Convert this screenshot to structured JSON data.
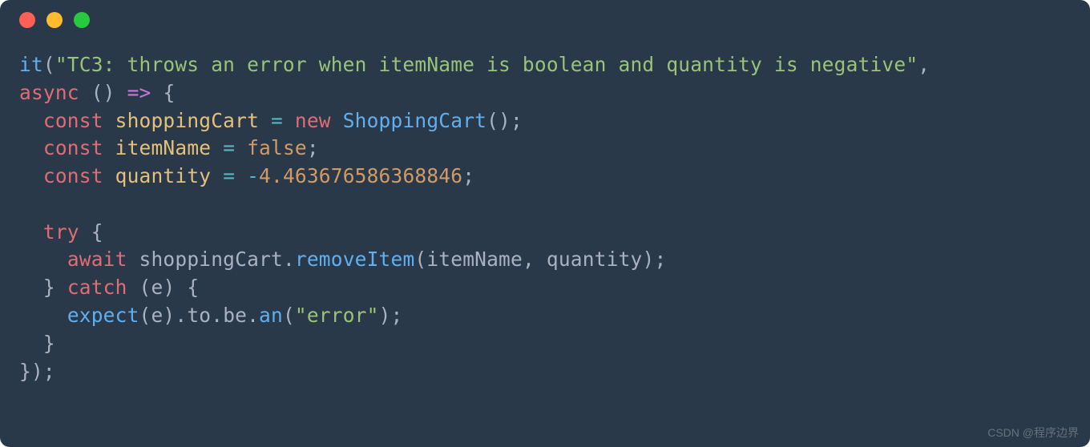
{
  "colors": {
    "bg": "#293949",
    "red_dot": "#ff5f56",
    "yellow_dot": "#ffbd2e",
    "green_dot": "#27c93f"
  },
  "watermark": "CSDN @程序边界",
  "code": {
    "line1": {
      "fn": "it",
      "paren_open": "(",
      "str": "\"TC3: throws an error when itemName is boolean and quantity is negative\"",
      "comma": ","
    },
    "line2": {
      "kw_async": "async",
      "sp1": " ",
      "paren": "()",
      "sp2": " ",
      "arrow": "=>",
      "sp3": " ",
      "brace": "{"
    },
    "line3": {
      "indent": "  ",
      "kw_const": "const",
      "sp1": " ",
      "var": "shoppingCart",
      "sp2": " ",
      "eq": "=",
      "sp3": " ",
      "kw_new": "new",
      "sp4": " ",
      "class": "ShoppingCart",
      "paren": "()",
      "semi": ";"
    },
    "line4": {
      "indent": "  ",
      "kw_const": "const",
      "sp1": " ",
      "var": "itemName",
      "sp2": " ",
      "eq": "=",
      "sp3": " ",
      "val": "false",
      "semi": ";"
    },
    "line5": {
      "indent": "  ",
      "kw_const": "const",
      "sp1": " ",
      "var": "quantity",
      "sp2": " ",
      "eq": "=",
      "sp3": " ",
      "minus": "-",
      "val": "4.463676586368846",
      "semi": ";"
    },
    "line6": {
      "blank": ""
    },
    "line7": {
      "indent": "  ",
      "kw_try": "try",
      "sp1": " ",
      "brace": "{"
    },
    "line8": {
      "indent": "    ",
      "kw_await": "await",
      "sp1": " ",
      "obj": "shoppingCart",
      "dot": ".",
      "method": "removeItem",
      "paren_open": "(",
      "arg1": "itemName",
      "comma": ", ",
      "arg2": "quantity",
      "paren_close": ")",
      "semi": ";"
    },
    "line9": {
      "indent": "  ",
      "brace_close": "}",
      "sp1": " ",
      "kw_catch": "catch",
      "sp2": " ",
      "paren_open": "(",
      "arg": "e",
      "paren_close": ")",
      "sp3": " ",
      "brace_open": "{"
    },
    "line10": {
      "indent": "    ",
      "fn": "expect",
      "paren_open": "(",
      "arg": "e",
      "paren_close": ")",
      "dot1": ".",
      "prop1": "to",
      "dot2": ".",
      "prop2": "be",
      "dot3": ".",
      "method": "an",
      "paren_open2": "(",
      "str": "\"error\"",
      "paren_close2": ")",
      "semi": ";"
    },
    "line11": {
      "indent": "  ",
      "brace": "}"
    },
    "line12": {
      "brace": "}",
      "paren": ")",
      "semi": ";"
    }
  }
}
